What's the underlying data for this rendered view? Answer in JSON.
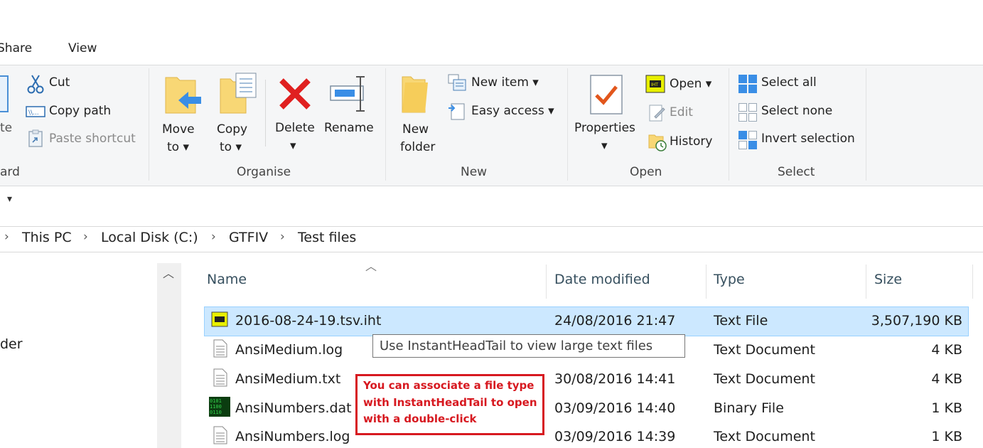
{
  "tabs": [
    "Share",
    "View"
  ],
  "clipboard": {
    "paste_partial": "te",
    "cut": "Cut",
    "copy_path": "Copy path",
    "paste_shortcut": "Paste shortcut",
    "group_partial": "ard"
  },
  "organise": {
    "move_to": [
      "Move",
      "to ▾"
    ],
    "copy_to": [
      "Copy",
      "to ▾"
    ],
    "delete": "Delete",
    "delete_arrow": "▾",
    "rename": "Rename",
    "group": "Organise"
  },
  "new": {
    "new_folder": [
      "New",
      "folder"
    ],
    "new_item": "New item ▾",
    "easy_access": "Easy access ▾",
    "group": "New"
  },
  "open": {
    "properties": "Properties",
    "properties_arrow": "▾",
    "open": "Open ▾",
    "edit": "Edit",
    "history": "History",
    "group": "Open"
  },
  "select": {
    "select_all": "Select all",
    "select_none": "Select none",
    "invert_selection": "Invert selection",
    "group": "Select"
  },
  "quick_access_toggle": "▾",
  "breadcrumb": [
    "This PC",
    "Local Disk (C:)",
    "GTFIV",
    "Test files"
  ],
  "nav": {
    "partial_folder": "der"
  },
  "columns": [
    "Name",
    "Date modified",
    "Type",
    "Size"
  ],
  "files": [
    {
      "name": "2016-08-24-19.tsv.iht",
      "date": "24/08/2016 21:47",
      "type": "Text File",
      "size": "3,507,190 KB",
      "icon": "iht-file-icon",
      "selected": true
    },
    {
      "name": "AnsiMedium.log",
      "date": "",
      "type": "Text Document",
      "size": "4 KB",
      "icon": "text-file-icon"
    },
    {
      "name": "AnsiMedium.txt",
      "date": "30/08/2016 14:41",
      "type": "Text Document",
      "size": "4 KB",
      "icon": "text-file-icon"
    },
    {
      "name": "AnsiNumbers.dat",
      "date": "03/09/2016 14:40",
      "type": "Binary File",
      "size": "1 KB",
      "icon": "binary-file-icon"
    },
    {
      "name": "AnsiNumbers.log",
      "date": "03/09/2016 14:39",
      "type": "Text Document",
      "size": "1 KB",
      "icon": "text-file-icon"
    }
  ],
  "tooltip": "Use InstantHeadTail to view large text files",
  "annotation": [
    "You can associate a file type",
    "with InstantHeadTail to open",
    "with a double-click"
  ],
  "colors": {
    "selection": "#cce8ff",
    "annotation_red": "#d71920",
    "ribbon_bg": "#f5f6f7"
  }
}
